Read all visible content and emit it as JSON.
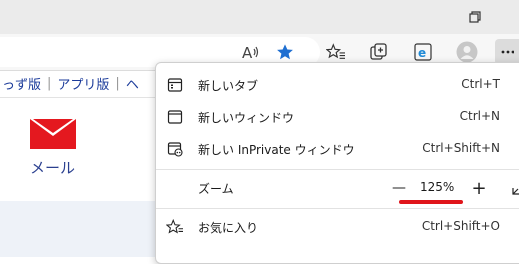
{
  "colors": {
    "accent_blue": "#1f6fd1",
    "annotation_red": "#e0151b",
    "mail_red": "#e4181f"
  },
  "page": {
    "links": [
      "っず版",
      "アプリ版",
      "ヘ"
    ],
    "mail_label": "メール"
  },
  "menu": {
    "items": [
      {
        "label": "新しいタブ",
        "shortcut": "Ctrl+T",
        "icon": "new-tab-icon"
      },
      {
        "label": "新しいウィンドウ",
        "shortcut": "Ctrl+N",
        "icon": "new-window-icon"
      },
      {
        "label": "新しい InPrivate ウィンドウ",
        "shortcut": "Ctrl+Shift+N",
        "icon": "inprivate-icon"
      }
    ],
    "zoom": {
      "label": "ズーム",
      "value": "125%",
      "minus": "—",
      "plus": "+"
    },
    "favorites": {
      "label": "お気に入り",
      "shortcut": "Ctrl+Shift+O",
      "icon": "favorites-icon"
    }
  }
}
